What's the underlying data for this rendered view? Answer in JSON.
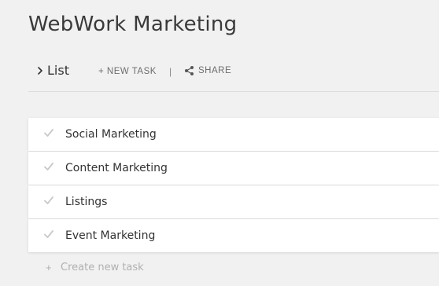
{
  "project": {
    "title": "WebWork Marketing"
  },
  "toolbar": {
    "view_label": "List",
    "view_icon": "chevron-right-icon",
    "new_task_label": "+ NEW TASK",
    "separator": "|",
    "share_label": "SHARE",
    "share_icon": "share-icon"
  },
  "tasks": [
    {
      "name": "Social Marketing",
      "completed": false
    },
    {
      "name": "Content Marketing",
      "completed": false
    },
    {
      "name": "Listings",
      "completed": false
    },
    {
      "name": "Event Marketing",
      "completed": false
    }
  ],
  "create_task": {
    "icon": "+",
    "label": "Create new task"
  },
  "colors": {
    "background": "#f1f1f1",
    "row_background": "#ffffff",
    "check": "#c8c8c8",
    "muted_text": "#b0b0b0"
  }
}
